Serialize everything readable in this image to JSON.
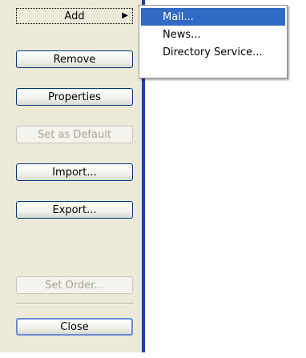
{
  "buttons": {
    "add": "Add",
    "remove": "Remove",
    "properties": "Properties",
    "set_default": "Set as Default",
    "import": "Import...",
    "export": "Export...",
    "set_order": "Set Order...",
    "close": "Close"
  },
  "add_menu": {
    "items": [
      "Mail...",
      "News...",
      "Directory Service..."
    ],
    "highlighted_index": 0
  },
  "icons": {
    "submenu_arrow": "submenu-arrow-icon"
  },
  "colors": {
    "panel_bg": "#ece9d8",
    "menu_highlight": "#316ac5",
    "border_blue": "#1c3fb4",
    "disabled_text": "#a7a596"
  }
}
